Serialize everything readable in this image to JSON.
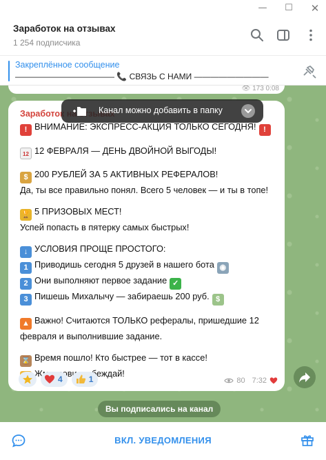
{
  "window": {
    "controls": [
      "minimize",
      "maximize",
      "close"
    ]
  },
  "header": {
    "title": "Заработок на отзывах",
    "subtitle": "1 254 подписчика",
    "icons": [
      "search-icon",
      "sidebar-toggle-icon",
      "more-icon"
    ]
  },
  "pinned": {
    "title": "Закреплённое сообщение",
    "text": "———————————— 📞 СВЯЗЬ С НАМИ —————————"
  },
  "prev_message": {
    "meta": "👁 173  0:08"
  },
  "toast": {
    "text": "Канал можно добавить в папку"
  },
  "message": {
    "channel_name": "Заработок на отзывах",
    "lines": {
      "l1": "ВНИМАНИЕ: ЭКСПРЕСС-АКЦИЯ ТОЛЬКО СЕГОДНЯ!",
      "l2": "12 ФЕВРАЛЯ — ДЕНЬ ДВОЙНОЙ ВЫГОДЫ!",
      "l3": "200 РУБЛЕЙ ЗА 5 АКТИВНЫХ РЕФЕРАЛОВ!",
      "l4": "Да, ты все правильно понял. Всего 5 человек — и ты в топе!",
      "l5": "5 ПРИЗОВЫХ МЕСТ!",
      "l6": "Успей попасть в пятерку самых быстрых!",
      "l7": "УСЛОВИЯ ПРОЩЕ ПРОСТОГО:",
      "l8": "Приводишь сегодня 5 друзей в нашего бота",
      "l9": "Они выполняют первое задание",
      "l10": "Пишешь Михалычу — забираешь 200 руб.",
      "l11": "Важно! Считаются ТОЛЬКО рефералы, пришедшие 12",
      "l12": "февраля и выполнившие задание.",
      "l13": "Время пошло! Кто быстрее — тот в кассе!",
      "l14": "Жми, зови, побеждай!"
    },
    "reactions": [
      {
        "icon": "star-icon",
        "count": ""
      },
      {
        "icon": "heart-icon",
        "count": "4"
      },
      {
        "icon": "thumbs-up-icon",
        "count": "1"
      }
    ],
    "views": "80",
    "time": "7:32"
  },
  "service_message": "Вы подписались на канал",
  "bottom": {
    "action_label": "ВКЛ. УВЕДОМЛЕНИЯ"
  },
  "colors": {
    "accent": "#3390ec",
    "chat_bg": "#8fb67e",
    "channel_name": "#d3433b"
  }
}
